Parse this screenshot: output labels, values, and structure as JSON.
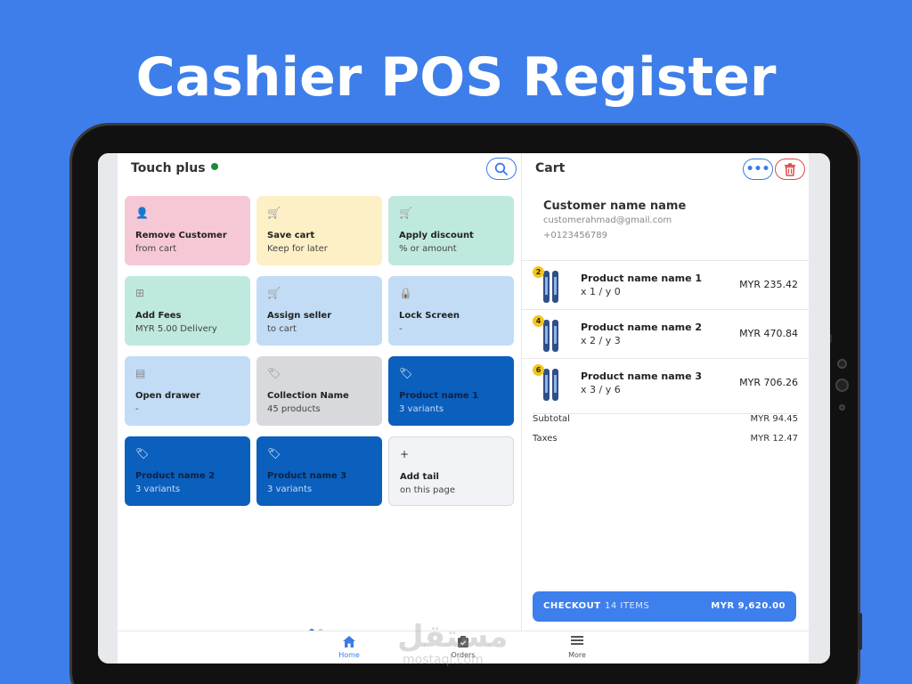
{
  "headline": "Cashier POS Register",
  "left": {
    "title": "Touch plus",
    "tiles": [
      {
        "line1": "Remove Customer",
        "line2": "from cart",
        "bg": "#f6c8d6",
        "icon": "user-icon",
        "glyph": "👤",
        "iconColor": "#e05656"
      },
      {
        "line1": "Save cart",
        "line2": "Keep for later",
        "bg": "#fdefc6",
        "icon": "cart-icon",
        "glyph": "🛒",
        "iconColor": "#888"
      },
      {
        "line1": "Apply discount",
        "line2": "% or amount",
        "bg": "#bfe9de",
        "icon": "cart-icon",
        "glyph": "🛒",
        "iconColor": "#888"
      },
      {
        "line1": "Add Fees",
        "line2": "MYR 5.00 Delivery",
        "bg": "#bfe9de",
        "icon": "add-fee-icon",
        "glyph": "⊞",
        "iconColor": "#888"
      },
      {
        "line1": "Assign seller",
        "line2": "to cart",
        "bg": "#c2dcf5",
        "icon": "cart-icon",
        "glyph": "🛒",
        "iconColor": "#888"
      },
      {
        "line1": "Lock Screen",
        "line2": "-",
        "bg": "#c2dcf5",
        "icon": "lock-icon",
        "glyph": "🔒",
        "iconColor": "#888"
      },
      {
        "line1": "Open drawer",
        "line2": "-",
        "bg": "#c2dcf5",
        "icon": "drawer-icon",
        "glyph": "▤",
        "iconColor": "#888"
      },
      {
        "line1": "Collection Name",
        "line2": "45 products",
        "bg": "#d8d9dc",
        "icon": "tag-icon",
        "glyph": "🏷",
        "iconColor": "#888"
      },
      {
        "line1": "Product name 1",
        "line2": "3 variants",
        "bg": "#0b5fbd",
        "icon": "tag-icon",
        "glyph": "🏷",
        "iconColor": "#ffffff",
        "dark": true
      },
      {
        "line1": "Product name 2",
        "line2": "3 variants",
        "bg": "#0b5fbd",
        "icon": "tag-icon",
        "glyph": "🏷",
        "iconColor": "#ffffff",
        "dark": true
      },
      {
        "line1": "Product name 3",
        "line2": "3 variants",
        "bg": "#0b5fbd",
        "icon": "tag-icon",
        "glyph": "🏷",
        "iconColor": "#ffffff",
        "dark": true
      },
      {
        "line1": "Add tail",
        "line2": "on this page",
        "bg": "#f1f3f6",
        "icon": "plus-icon",
        "glyph": "+",
        "iconColor": "#333"
      }
    ]
  },
  "cart": {
    "title": "Cart",
    "more_label": "•••",
    "customer": {
      "name": "Customer name name",
      "email": "customerahmad@gmail.com",
      "phone": "+0123456789"
    },
    "items": [
      {
        "badge": "2",
        "name": "Product name name 1",
        "qty": "x 1 / y 0",
        "price": "MYR 235.42"
      },
      {
        "badge": "4",
        "name": "Product name name 2",
        "qty": "x 2 / y 3",
        "price": "MYR 470.84"
      },
      {
        "badge": "6",
        "name": "Product name name 3",
        "qty": "x 3 / y 6",
        "price": "MYR 706.26"
      }
    ],
    "subtotal_label": "Subtotal",
    "subtotal_value": "MYR 94.45",
    "taxes_label": "Taxes",
    "taxes_value": "MYR 12.47",
    "checkout_label": "CHECKOUT",
    "checkout_items": "14 ITEMS",
    "checkout_amount": "MYR 9,620.00"
  },
  "nav": {
    "home": "Home",
    "orders": "Orders",
    "more": "More"
  },
  "watermark": "مستقل",
  "watermark_sub": "mostaql.com",
  "colors": {
    "background": "#3d7eea",
    "accent": "#3b7be8",
    "danger": "#e04848",
    "online": "#1c8a3a"
  }
}
